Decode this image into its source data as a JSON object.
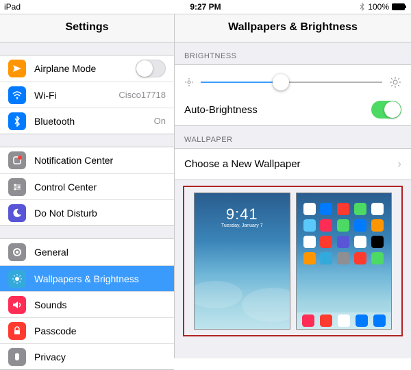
{
  "statusbar": {
    "device": "iPad",
    "time": "9:27 PM",
    "battery": "100%"
  },
  "sidebar": {
    "title": "Settings",
    "group1": [
      {
        "icon": "airplane",
        "color": "#ff9500",
        "label": "Airplane Mode",
        "accessory": "switch-off"
      },
      {
        "icon": "wifi",
        "color": "#007aff",
        "label": "Wi-Fi",
        "value": "Cisco17718"
      },
      {
        "icon": "bluetooth",
        "color": "#007aff",
        "label": "Bluetooth",
        "value": "On"
      }
    ],
    "group2": [
      {
        "icon": "notification",
        "color": "#8e8e93",
        "label": "Notification Center"
      },
      {
        "icon": "control",
        "color": "#8e8e93",
        "label": "Control Center"
      },
      {
        "icon": "moon",
        "color": "#5856d6",
        "label": "Do Not Disturb"
      }
    ],
    "group3": [
      {
        "icon": "gear",
        "color": "#8e8e93",
        "label": "General"
      },
      {
        "icon": "brightness",
        "color": "#34aadc",
        "label": "Wallpapers & Brightness",
        "selected": true
      },
      {
        "icon": "sounds",
        "color": "#ff2d55",
        "label": "Sounds"
      },
      {
        "icon": "lock",
        "color": "#ff3b30",
        "label": "Passcode"
      },
      {
        "icon": "hand",
        "color": "#8e8e93",
        "label": "Privacy"
      }
    ]
  },
  "detail": {
    "title": "Wallpapers & Brightness",
    "brightness_label": "BRIGHTNESS",
    "auto_label": "Auto-Brightness",
    "slider_percent": 44,
    "auto_on": true,
    "wallpaper_label": "WALLPAPER",
    "choose_label": "Choose a New Wallpaper",
    "lock_time": "9:41",
    "lock_date": "Tuesday, January 7"
  }
}
